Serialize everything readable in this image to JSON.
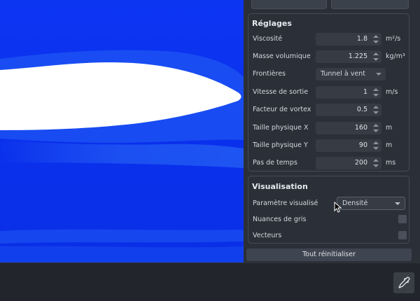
{
  "settings": {
    "title": "Réglages",
    "rows": [
      {
        "label": "Viscosité",
        "value": "1.8",
        "unit": "m²/s"
      },
      {
        "label": "Masse volumique",
        "value": "1.225",
        "unit": "kg/m³"
      },
      {
        "label": "Frontières",
        "select": "Tunnel à vent"
      },
      {
        "label": "Vitesse de sortie",
        "value": "1",
        "unit": "m/s"
      },
      {
        "label": "Facteur de vortex",
        "value": "0.5",
        "unit": ""
      },
      {
        "label": "Taille physique X",
        "value": "160",
        "unit": "m"
      },
      {
        "label": "Taille physique Y",
        "value": "90",
        "unit": "m"
      },
      {
        "label": "Pas de temps",
        "value": "200",
        "unit": "ms"
      }
    ]
  },
  "visualisation": {
    "title": "Visualisation",
    "parameter_label": "Paramètre visualisé",
    "parameter_value": "Densité",
    "grayscale_label": "Nuances de gris",
    "grayscale_checked": false,
    "vectors_label": "Vecteurs",
    "vectors_checked": false
  },
  "reset_label": "Tout réinitialiser",
  "icons": {
    "color_picker": "eyedropper-icon"
  },
  "colors": {
    "flow_blue": "#0a32f0",
    "airfoil": "#ffffff",
    "panel_bg": "#2b3038"
  }
}
